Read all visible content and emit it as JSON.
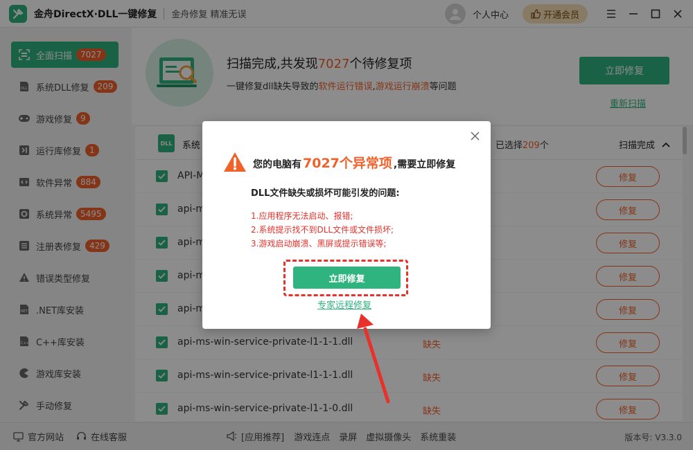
{
  "app": {
    "title": "金舟DirectX·DLL一键修复",
    "slogan": "金舟修复 精准无误",
    "personal_center": "个人中心",
    "vip_button": "开通会员"
  },
  "sidebar": {
    "items": [
      {
        "label": "全面扫描",
        "badge": "7027",
        "icon": "scan-icon",
        "active": true
      },
      {
        "label": "系统DLL修复",
        "badge": "209",
        "icon": "dll-icon"
      },
      {
        "label": "游戏修复",
        "badge": "9",
        "icon": "gamepad-icon"
      },
      {
        "label": "运行库修复",
        "badge": "1",
        "icon": "vs-icon"
      },
      {
        "label": "软件异常",
        "badge": "884",
        "icon": "code-icon"
      },
      {
        "label": "系统异常",
        "badge": "5495",
        "icon": "gear-icon"
      },
      {
        "label": "注册表修复",
        "badge": "429",
        "icon": "list-icon"
      },
      {
        "label": "错误类型修复",
        "badge": "",
        "icon": "warning-icon"
      },
      {
        "label": ".NET库安装",
        "badge": "",
        "icon": "net-icon"
      },
      {
        "label": "C++库安装",
        "badge": "",
        "icon": "cpp-icon"
      },
      {
        "label": "游戏库安装",
        "badge": "",
        "icon": "pacman-icon"
      },
      {
        "label": "手动修复",
        "badge": "",
        "icon": "wrench-icon"
      }
    ]
  },
  "header": {
    "title_prefix": "扫描完成,共发现",
    "title_count": "7027",
    "title_suffix": "个待修复项",
    "sub_prefix": "一键修复dll缺失导致的",
    "sub_hl1": "软件运行错误",
    "sub_sep": ",",
    "sub_hl2": "游戏运行崩溃",
    "sub_suffix": "等问题",
    "fix_now": "立即修复",
    "rescan": "重新扫描"
  },
  "list": {
    "head_label": "系统",
    "selected_prefix": "已选择",
    "selected_count": "209",
    "selected_suffix": "个",
    "status": "扫描完成",
    "rows": [
      {
        "name": "API-M",
        "status": "",
        "action": "修复"
      },
      {
        "name": "api-m",
        "status": "",
        "action": "修复"
      },
      {
        "name": "api-m",
        "status": "",
        "action": "修复"
      },
      {
        "name": "api-m",
        "status": "",
        "action": "修复"
      },
      {
        "name": "api-m",
        "status": "",
        "action": "修复"
      },
      {
        "name": "api-ms-win-service-private-l1-1-1.dll",
        "status": "缺失",
        "action": "修复"
      },
      {
        "name": "api-ms-win-service-private-l1-1-1.dll",
        "status": "缺失",
        "action": "修复"
      },
      {
        "name": "api-ms-win-service-private-l1-1-0.dll",
        "status": "缺失",
        "action": "修复"
      }
    ]
  },
  "bottom": {
    "website": "官方网站",
    "support": "在线客服",
    "recommend": "[应用推荐]",
    "links": [
      "游戏连点",
      "录屏",
      "虚拟摄像头",
      "系统重装"
    ],
    "version": "版本号: V3.3.0"
  },
  "dialog": {
    "line1_prefix": "您的电脑有",
    "line1_count": "7027个异常项",
    "line1_suffix": ",需要立即修复",
    "line2": "DLL文件缺失或损坏可能引发的问题:",
    "problems": [
      "1.应用程序无法启动、报错;",
      "2.系统提示找不到DLL文件或文件损坏;",
      "3.游戏启动崩溃、黑屏或提示错误等;"
    ],
    "fix_button": "立即修复",
    "remote_link": "专家远程修复"
  },
  "colors": {
    "accent": "#2fb37f",
    "highlight": "#f0612b",
    "warning_red": "#e8312b"
  }
}
